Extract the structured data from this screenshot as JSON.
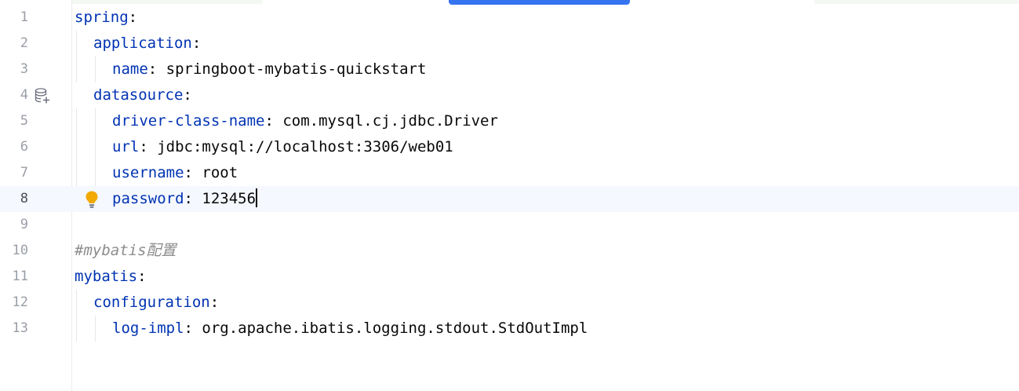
{
  "editor": {
    "current_line": 8,
    "lines": [
      {
        "num": "1",
        "indent": 0,
        "key": "spring",
        "sep": ":",
        "value": ""
      },
      {
        "num": "2",
        "indent": 1,
        "key": "application",
        "sep": ":",
        "value": ""
      },
      {
        "num": "3",
        "indent": 2,
        "key": "name",
        "sep": ":",
        "value": " springboot-mybatis-quickstart"
      },
      {
        "num": "4",
        "indent": 1,
        "key": "datasource",
        "sep": ":",
        "value": ""
      },
      {
        "num": "5",
        "indent": 2,
        "key": "driver-class-name",
        "sep": ":",
        "value": " com.mysql.cj.jdbc.Driver"
      },
      {
        "num": "6",
        "indent": 2,
        "key": "url",
        "sep": ":",
        "value": " jdbc:mysql://localhost:3306/web01"
      },
      {
        "num": "7",
        "indent": 2,
        "key": "username",
        "sep": ":",
        "value": " root"
      },
      {
        "num": "8",
        "indent": 2,
        "key": "password",
        "sep": ":",
        "value": " 123456"
      },
      {
        "num": "9",
        "indent": 0,
        "key": "",
        "sep": "",
        "value": ""
      },
      {
        "num": "10",
        "indent": 0,
        "comment": "#mybatis配置"
      },
      {
        "num": "11",
        "indent": 0,
        "key": "mybatis",
        "sep": ":",
        "value": ""
      },
      {
        "num": "12",
        "indent": 1,
        "key": "configuration",
        "sep": ":",
        "value": ""
      },
      {
        "num": "13",
        "indent": 2,
        "key": "log-impl",
        "sep": ":",
        "value": " org.apache.ibatis.logging.stdout.StdOutImpl"
      }
    ]
  },
  "icons": {
    "line4_gutter": "database-add-icon",
    "line8_gutter": "lightbulb-icon"
  },
  "colors": {
    "key": "#0033b3",
    "text": "#080808",
    "comment": "#8c8c8c",
    "line_number": "#9a9ea8",
    "current_line_bg": "#f5f8fe",
    "scroll_thumb": "#3574f0",
    "bulb": "#f2a900"
  }
}
